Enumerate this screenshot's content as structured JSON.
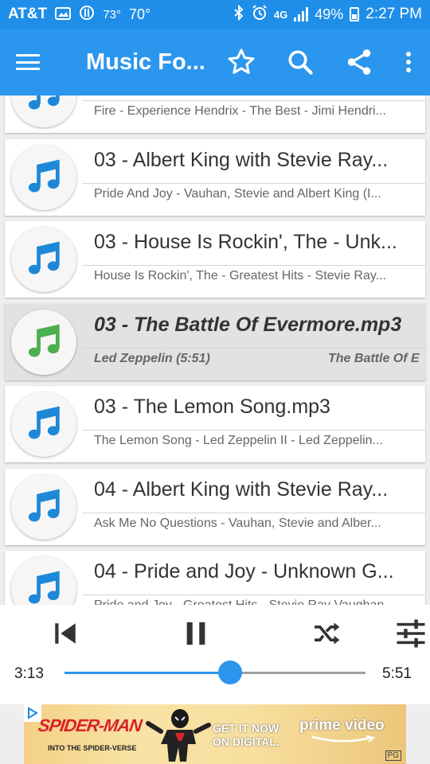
{
  "status_bar": {
    "carrier": "AT&T",
    "temp1": "73°",
    "temp2": "70°",
    "network": "4G",
    "battery": "49%",
    "time": "2:27 PM"
  },
  "app_bar": {
    "title": "Music Fo..."
  },
  "tracks": [
    {
      "title": "",
      "subtitle": "Fire - Experience Hendrix - The Best - Jimi Hendri...",
      "active": false
    },
    {
      "title": "03 - Albert King with Stevie Ray...",
      "subtitle": "Pride And Joy - Vauhan, Stevie and Albert King (I...",
      "active": false
    },
    {
      "title": "03 - House Is Rockin', The - Unk...",
      "subtitle": "House Is Rockin', The - Greatest Hits - Stevie Ray...",
      "active": false
    },
    {
      "title": "03 - The Battle Of Evermore.mp3",
      "subtitle": "Led Zeppelin (5:51)",
      "subtitle2": "The Battle Of E",
      "active": true
    },
    {
      "title": "03 - The Lemon Song.mp3",
      "subtitle": "The Lemon Song - Led Zeppelin II - Led Zeppelin...",
      "active": false
    },
    {
      "title": "04 - Albert King with Stevie Ray...",
      "subtitle": "Ask Me No Questions - Vauhan, Stevie and Alber...",
      "active": false
    },
    {
      "title": "04 - Pride and Joy - Unknown G...",
      "subtitle": "Pride and Joy - Greatest Hits - Stevie Ray Vaughan...",
      "active": false
    }
  ],
  "player": {
    "elapsed": "3:13",
    "duration": "5:51",
    "progress": 0.55
  },
  "ad": {
    "headline": "SPIDER-MAN",
    "subline": "INTO THE SPIDER-VERSE",
    "cta_line1": "GET IT NOW",
    "cta_line2": "ON DIGITAL.",
    "brand": "prime video",
    "rating": "PG"
  },
  "colors": {
    "accent": "#2b96ee",
    "note_blue": "#1e88d8",
    "note_green": "#4caf50"
  }
}
